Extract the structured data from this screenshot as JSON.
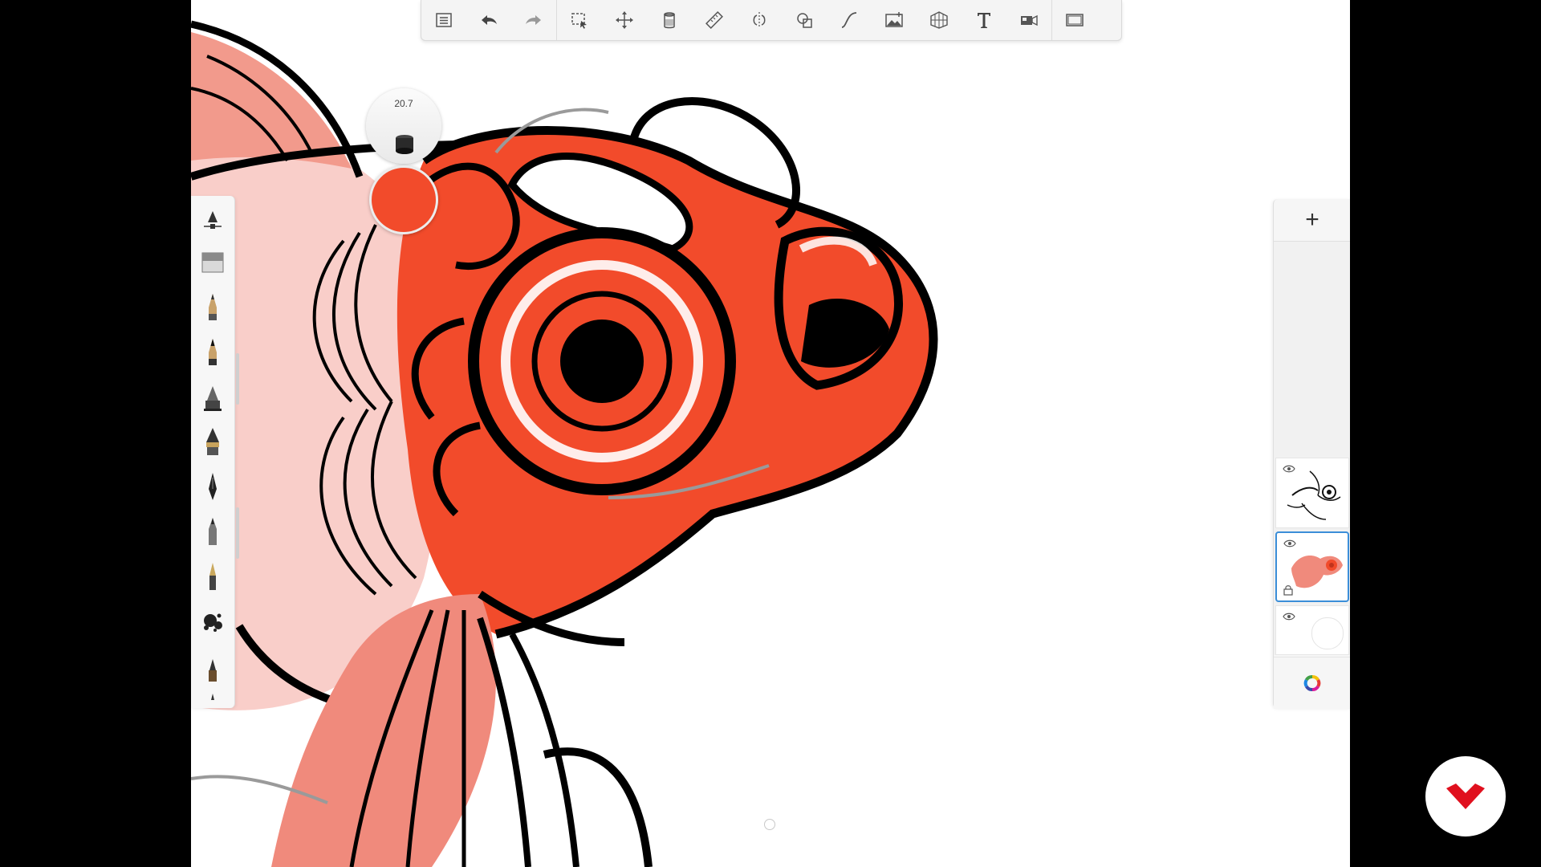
{
  "toolbar": {
    "items": [
      {
        "name": "menu",
        "icon": "list-icon"
      },
      {
        "name": "undo",
        "icon": "undo-icon"
      },
      {
        "name": "redo",
        "icon": "redo-icon"
      },
      {
        "name": "selection",
        "icon": "selection-icon"
      },
      {
        "name": "transform",
        "icon": "move-icon"
      },
      {
        "name": "fill",
        "icon": "fill-bucket-icon"
      },
      {
        "name": "ruler",
        "icon": "ruler-icon"
      },
      {
        "name": "symmetry",
        "icon": "symmetry-icon"
      },
      {
        "name": "predictive-stroke",
        "icon": "shapes-icon"
      },
      {
        "name": "steady-stroke",
        "icon": "curve-icon"
      },
      {
        "name": "import-image",
        "icon": "image-icon"
      },
      {
        "name": "perspective",
        "icon": "perspective-grid-icon"
      },
      {
        "name": "text",
        "icon": "text-icon"
      },
      {
        "name": "time-lapse",
        "icon": "video-icon"
      },
      {
        "name": "fullscreen",
        "icon": "fullscreen-icon"
      }
    ]
  },
  "brush_puck": {
    "size_value": "20.7",
    "color": "#f24b2b"
  },
  "brushes": [
    "brush-settings-icon",
    "eraser-icon",
    "pencil-icon",
    "pencil-dark-icon",
    "airbrush-icon",
    "paint-brush-icon",
    "ink-pen-icon",
    "marker-icon",
    "fountain-pen-icon",
    "splatter-icon",
    "chisel-marker-icon",
    "more-brushes-icon"
  ],
  "layers": {
    "add_label": "+",
    "items": [
      {
        "name": "linework-layer",
        "visible": true,
        "selected": false
      },
      {
        "name": "color-layer",
        "visible": true,
        "selected": true,
        "locked": true
      },
      {
        "name": "background-layer",
        "visible": true,
        "selected": false
      }
    ]
  },
  "colors": {
    "accent": "#f24b2b",
    "selection": "#3b8ed8",
    "logo": "#e0101e"
  }
}
